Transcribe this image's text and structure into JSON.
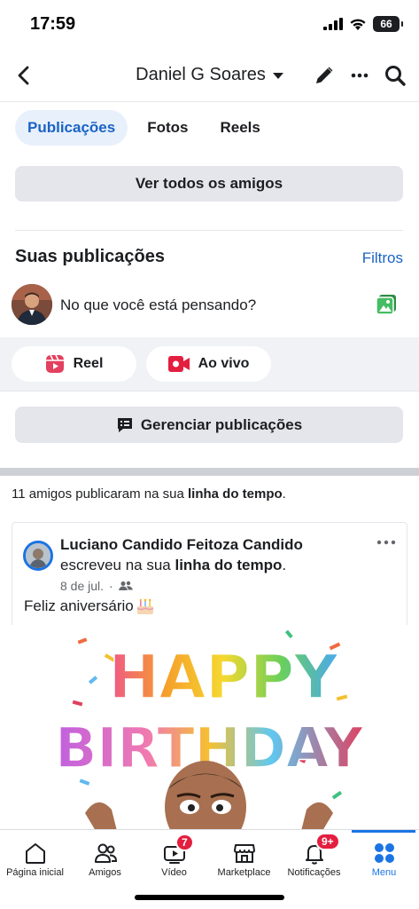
{
  "status_bar": {
    "time": "17:59",
    "battery": "66"
  },
  "nav": {
    "title": "Daniel G Soares"
  },
  "tabs": [
    {
      "label": "Publicações",
      "active": true
    },
    {
      "label": "Fotos",
      "active": false
    },
    {
      "label": "Reels",
      "active": false
    }
  ],
  "see_all_friends": "Ver todos os amigos",
  "posts_section": {
    "title": "Suas publicações",
    "filter": "Filtros"
  },
  "composer": {
    "placeholder": "No que você está pensando?"
  },
  "actions": {
    "reel": "Reel",
    "live": "Ao vivo"
  },
  "manage_posts": "Gerenciar publicações",
  "timeline": {
    "prefix": "11 amigos publicaram na sua ",
    "link": "linha do tempo",
    "suffix": "."
  },
  "post": {
    "author": "Luciano Candido Feitoza Candido",
    "action_prefix": "escreveu na sua ",
    "action_link": "linha do tempo",
    "action_suffix": ".",
    "date": "8 de jul.",
    "separator": "·",
    "body": "Feliz aniversário"
  },
  "birthday_image_text": {
    "line1": "HAPPY",
    "line2": "BIRTHDAY"
  },
  "tabbar": [
    {
      "label": "Página inicial",
      "icon": "home-icon"
    },
    {
      "label": "Amigos",
      "icon": "friends-icon"
    },
    {
      "label": "Vídeo",
      "icon": "video-icon",
      "badge": "7"
    },
    {
      "label": "Marketplace",
      "icon": "marketplace-icon"
    },
    {
      "label": "Notificações",
      "icon": "bell-icon",
      "badge": "9+"
    },
    {
      "label": "Menu",
      "icon": "menu-icon",
      "active": true
    }
  ],
  "colors": {
    "accent": "#1b74e4",
    "badge": "#e41e3f",
    "reel": "#e4405f",
    "live": "#e41e3f",
    "photo": "#45bd62"
  }
}
